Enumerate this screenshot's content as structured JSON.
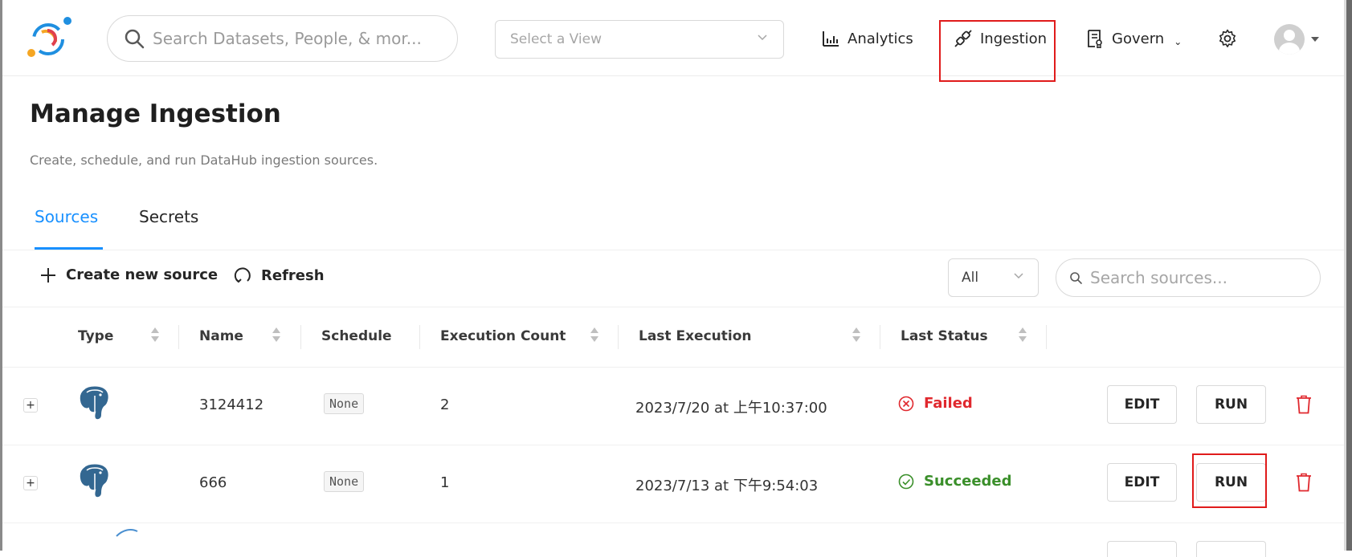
{
  "header": {
    "search_placeholder": "Search Datasets, People, & mor...",
    "view_placeholder": "Select a View",
    "nav": {
      "analytics": "Analytics",
      "ingestion": "Ingestion",
      "govern": "Govern"
    }
  },
  "page": {
    "title": "Manage Ingestion",
    "subtitle": "Create, schedule, and run DataHub ingestion sources."
  },
  "tabs": {
    "sources": "Sources",
    "secrets": "Secrets"
  },
  "toolbar": {
    "create_label": "Create new source",
    "refresh_label": "Refresh",
    "filter_value": "All",
    "search_placeholder": "Search sources..."
  },
  "table": {
    "headers": {
      "type": "Type",
      "name": "Name",
      "schedule": "Schedule",
      "execution_count": "Execution Count",
      "last_execution": "Last Execution",
      "last_status": "Last Status"
    },
    "rows": [
      {
        "type_icon": "postgres-icon",
        "name": "3124412",
        "schedule": "None",
        "execution_count": "2",
        "last_execution": "2023/7/20 at 上午10:37:00",
        "last_status": "Failed",
        "edit_label": "EDIT",
        "run_label": "RUN"
      },
      {
        "type_icon": "postgres-icon",
        "name": "666",
        "schedule": "None",
        "execution_count": "1",
        "last_execution": "2023/7/13 at 下午9:54:03",
        "last_status": "Succeeded",
        "edit_label": "EDIT",
        "run_label": "RUN"
      }
    ],
    "expand_symbol": "+"
  },
  "colors": {
    "accent": "#1890ff",
    "failed": "#e0282e",
    "succeeded": "#3a8f2a",
    "highlight": "#e01b1b"
  }
}
